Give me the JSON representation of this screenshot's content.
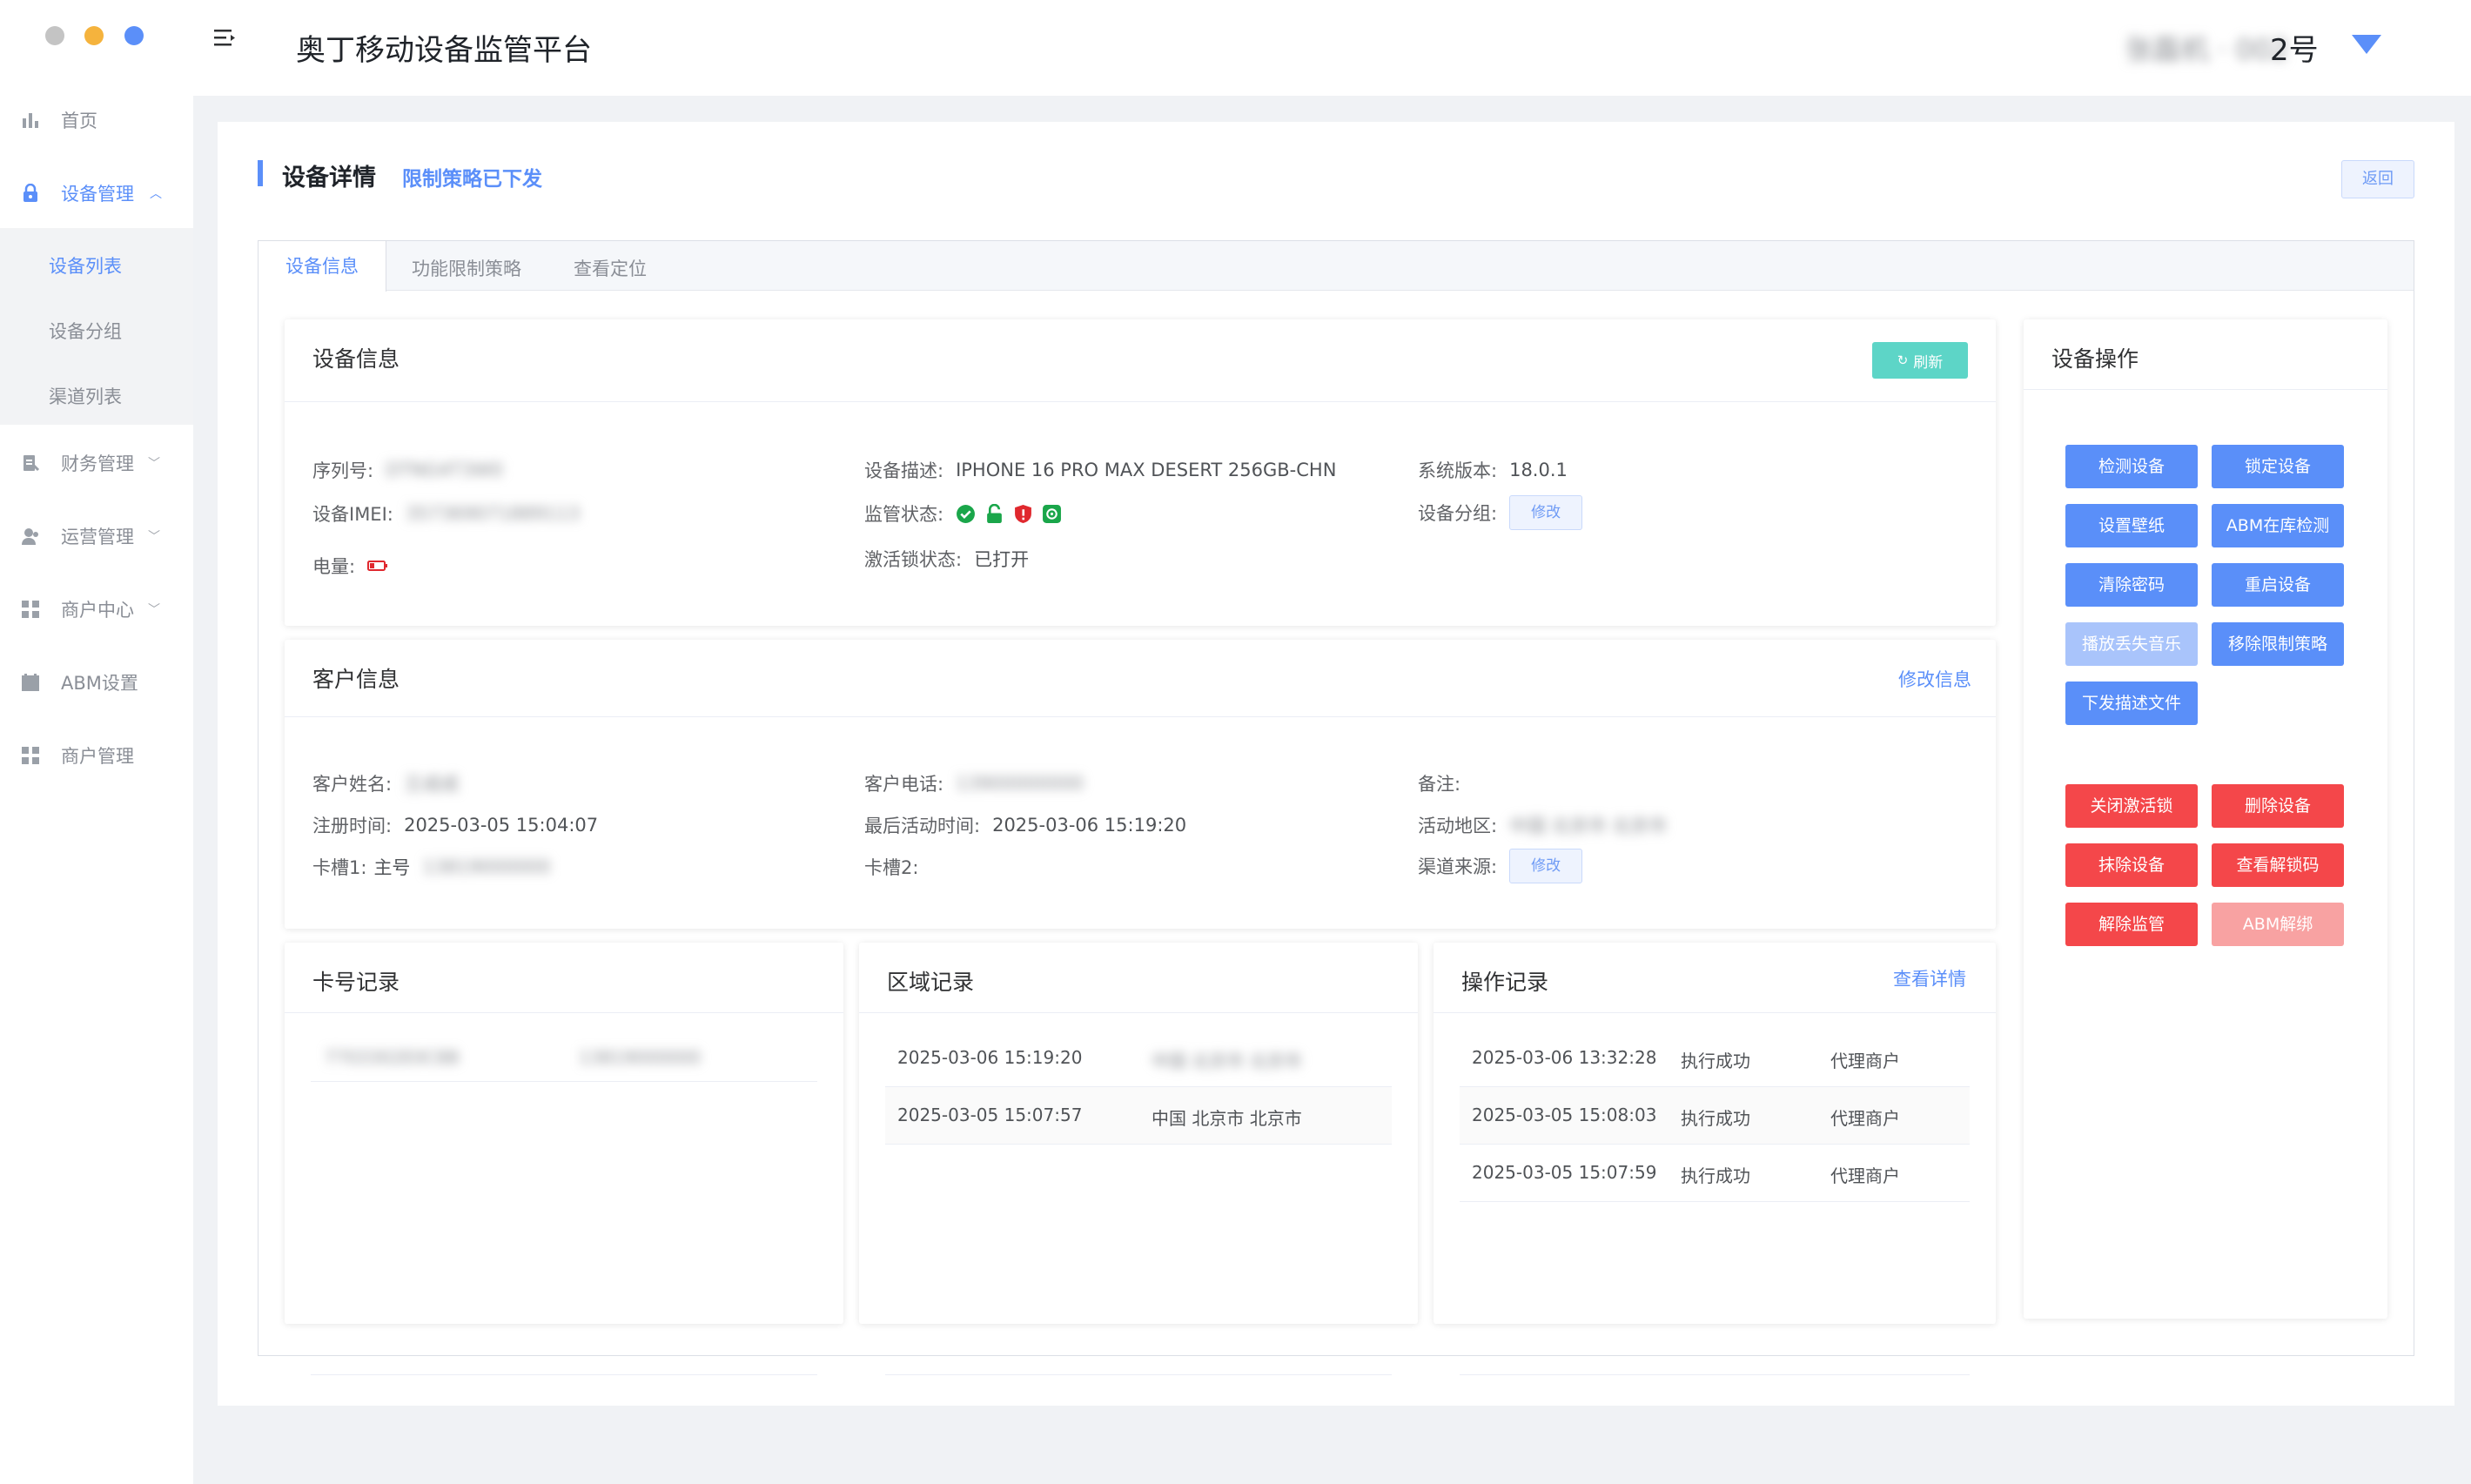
{
  "app": {
    "title": "奥丁移动设备监管平台",
    "user_blurred": "张磊机 · 002",
    "user_suffix": "2号"
  },
  "window_dots": [
    "#c4c4c4",
    "#f5b33d",
    "#5b8ff9"
  ],
  "sidebar": {
    "items": [
      {
        "label": "首页",
        "icon": "bar-chart-icon"
      },
      {
        "label": "设备管理",
        "icon": "lock-icon",
        "expanded": true
      },
      {
        "label": "财务管理",
        "icon": "document-icon"
      },
      {
        "label": "运营管理",
        "icon": "user-icon"
      },
      {
        "label": "商户中心",
        "icon": "grid-icon"
      },
      {
        "label": "ABM设置",
        "icon": "calendar-icon"
      },
      {
        "label": "商户管理",
        "icon": "grid-icon"
      }
    ],
    "sub_items": [
      {
        "label": "设备列表",
        "active": true
      },
      {
        "label": "设备分组"
      },
      {
        "label": "渠道列表"
      }
    ]
  },
  "page": {
    "title": "设备详情",
    "status": "限制策略已下发",
    "back_label": "返回"
  },
  "tabs": [
    {
      "label": "设备信息",
      "active": true
    },
    {
      "label": "功能限制策略"
    },
    {
      "label": "查看定位"
    }
  ],
  "device_info": {
    "title": "设备信息",
    "refresh_label": "刷新",
    "serial_label": "序列号:",
    "serial_value": "DTNG4T3W0",
    "imei_label": "设备IMEI:",
    "imei_value": "357369071889113",
    "battery_label": "电量:",
    "desc_label": "设备描述:",
    "desc_value": "IPHONE 16 PRO MAX DESERT 256GB-CHN",
    "supervision_label": "监管状态:",
    "activation_lock_label": "激活锁状态:",
    "activation_lock_value": "已打开",
    "os_label": "系统版本:",
    "os_value": "18.0.1",
    "group_label": "设备分组:",
    "modify_label": "修改"
  },
  "customer_info": {
    "title": "客户信息",
    "edit_label": "修改信息",
    "name_label": "客户姓名:",
    "name_value": "王成成",
    "reg_label": "注册时间:",
    "reg_value": "2025-03-05 15:04:07",
    "slot1_label": "卡槽1:",
    "slot1_prefix": "主号",
    "slot1_value": "13819000000",
    "phone_label": "客户电话:",
    "phone_value": "13900000000",
    "last_active_label": "最后活动时间:",
    "last_active_value": "2025-03-06 15:19:20",
    "slot2_label": "卡槽2:",
    "remark_label": "备注:",
    "region_label": "活动地区:",
    "region_value": "中国 北京市 北京市",
    "channel_label": "渠道来源:",
    "modify_label": "修改"
  },
  "card_records": {
    "title": "卡号记录",
    "rows": [
      {
        "col1": "7703302E0C8B",
        "col2": "13819000000"
      }
    ]
  },
  "region_records": {
    "title": "区域记录",
    "rows": [
      {
        "time": "2025-03-06 15:19:20",
        "region": "中国 北京市 北京市",
        "blurred": true
      },
      {
        "time": "2025-03-05 15:07:57",
        "region": "中国 北京市 北京市",
        "blurred": false
      }
    ]
  },
  "op_records": {
    "title": "操作记录",
    "detail_label": "查看详情",
    "rows": [
      {
        "time": "2025-03-06 13:32:28",
        "result": "执行成功",
        "operator": "代理商户"
      },
      {
        "time": "2025-03-05 15:08:03",
        "result": "执行成功",
        "operator": "代理商户"
      },
      {
        "time": "2025-03-05 15:07:59",
        "result": "执行成功",
        "operator": "代理商户"
      }
    ]
  },
  "device_ops": {
    "title": "设备操作",
    "blue": [
      {
        "label": "检测设备",
        "enabled": true
      },
      {
        "label": "锁定设备",
        "enabled": true
      },
      {
        "label": "设置壁纸",
        "enabled": true
      },
      {
        "label": "ABM在库检测",
        "enabled": true
      },
      {
        "label": "清除密码",
        "enabled": true
      },
      {
        "label": "重启设备",
        "enabled": true
      },
      {
        "label": "播放丢失音乐",
        "enabled": false
      },
      {
        "label": "移除限制策略",
        "enabled": true
      },
      {
        "label": "下发描述文件",
        "enabled": true
      }
    ],
    "red": [
      {
        "label": "关闭激活锁",
        "enabled": true
      },
      {
        "label": "删除设备",
        "enabled": true
      },
      {
        "label": "抹除设备",
        "enabled": true
      },
      {
        "label": "查看解锁码",
        "enabled": true
      },
      {
        "label": "解除监管",
        "enabled": true
      },
      {
        "label": "ABM解绑",
        "enabled": false
      }
    ]
  },
  "colors": {
    "accent": "#5b8ff9",
    "danger": "#f4474a",
    "teal": "#5dd5c7",
    "success": "#1aa64a",
    "lock_red": "#e0282e"
  }
}
